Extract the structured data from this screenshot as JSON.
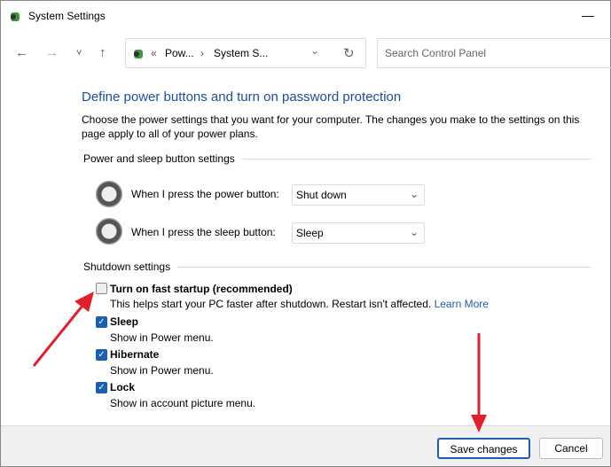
{
  "window": {
    "title": "System Settings",
    "minimize": "—"
  },
  "toolbar": {
    "back": "←",
    "forward": "→",
    "recent": "˅",
    "up": "↑",
    "breadcrumb_sep1": "«",
    "crumb1": "Pow...",
    "breadcrumb_sep2": "›",
    "crumb2": "System S...",
    "dropdown": "⌄",
    "refresh": "↻",
    "search_placeholder": "Search Control Panel"
  },
  "main": {
    "heading": "Define power buttons and turn on password protection",
    "description": "Choose the power settings that you want for your computer. The changes you make to the settings on this page apply to all of your power plans.",
    "power_section": "Power and sleep button settings",
    "power_label": "When I press the power button:",
    "power_value": "Shut down",
    "sleep_label": "When I press the sleep button:",
    "sleep_value": "Sleep",
    "shutdown_section": "Shutdown settings",
    "options": [
      {
        "label": "Turn on fast startup (recommended)",
        "desc": "This helps start your PC faster after shutdown. Restart isn't affected.",
        "link": "Learn More",
        "checked": false
      },
      {
        "label": "Sleep",
        "desc": "Show in Power menu.",
        "checked": true
      },
      {
        "label": "Hibernate",
        "desc": "Show in Power menu.",
        "checked": true
      },
      {
        "label": "Lock",
        "desc": "Show in account picture menu.",
        "checked": true
      }
    ]
  },
  "footer": {
    "save": "Save changes",
    "cancel": "Cancel"
  },
  "colors": {
    "accent": "#1a5fb4",
    "arrow": "#e0202a"
  }
}
